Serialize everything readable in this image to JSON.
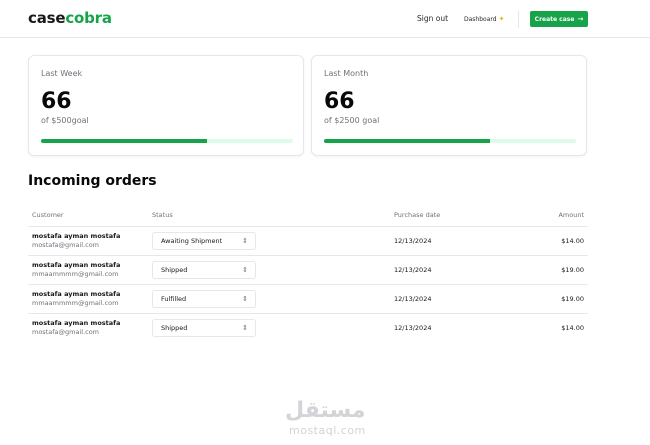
{
  "navbar": {
    "logo_part1": "case",
    "logo_part2": "cobra",
    "sign_out": "Sign out",
    "dashboard": "Dashboard",
    "dashboard_icon": "sparkles-icon",
    "create_case": "Create case",
    "create_case_icon": "arrow-right-icon"
  },
  "stats": [
    {
      "label": "Last Week",
      "value": "66",
      "goal": "of $500goal",
      "progress_percent": 66
    },
    {
      "label": "Last Month",
      "value": "66",
      "goal": "of $2500 goal",
      "progress_percent": 66
    }
  ],
  "orders": {
    "title": "Incoming orders",
    "columns": [
      "Customer",
      "Status",
      "Purchase date",
      "Amount"
    ],
    "rows": [
      {
        "name": "mostafa ayman mostafa",
        "email": "mostafa@gmail.com",
        "status": "Awaiting Shipment",
        "date": "12/13/2024",
        "amount": "$14.00"
      },
      {
        "name": "mostafa ayman mostafa",
        "email": "mmaammmm@gmail.com",
        "status": "Shipped",
        "date": "12/13/2024",
        "amount": "$19.00"
      },
      {
        "name": "mostafa ayman mostafa",
        "email": "mmaammmm@gmail.com",
        "status": "Fulfilled",
        "date": "12/13/2024",
        "amount": "$19.00"
      },
      {
        "name": "mostafa ayman mostafa",
        "email": "mostafa@gmail.com",
        "status": "Shipped",
        "date": "12/13/2024",
        "amount": "$14.00"
      }
    ]
  },
  "watermark": {
    "arabic": "مستقل",
    "latin": "mostaql.com"
  },
  "colors": {
    "accent": "#16a34a",
    "track": "#dcfce7"
  }
}
